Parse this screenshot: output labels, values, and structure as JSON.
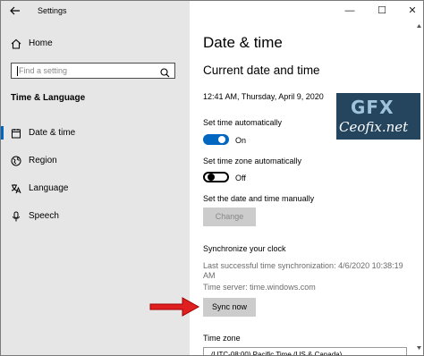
{
  "app": {
    "title": "Settings"
  },
  "sidebar": {
    "home_label": "Home",
    "search_placeholder": "Find a setting",
    "section_title": "Time & Language",
    "items": [
      {
        "label": "Date & time",
        "icon": "clock-icon",
        "active": true
      },
      {
        "label": "Region",
        "icon": "globe-icon"
      },
      {
        "label": "Language",
        "icon": "language-icon"
      },
      {
        "label": "Speech",
        "icon": "microphone-icon"
      }
    ]
  },
  "window_controls": {
    "minimize": "—",
    "maximize": "☐",
    "close": "✕"
  },
  "main": {
    "title": "Date & time",
    "subtitle": "Current date and time",
    "current_datetime": "12:41 AM, Thursday, April 9, 2020",
    "set_time_auto": {
      "label": "Set time automatically",
      "state": "On",
      "on": true
    },
    "set_tz_auto": {
      "label": "Set time zone automatically",
      "state": "Off",
      "on": false
    },
    "set_manual": {
      "label": "Set the date and time manually",
      "button": "Change"
    },
    "sync": {
      "heading": "Synchronize your clock",
      "last_sync_line1": "Last successful time synchronization: 4/6/2020 10:38:19",
      "last_sync_line2": "AM",
      "server": "Time server: time.windows.com",
      "button": "Sync now"
    },
    "timezone": {
      "heading": "Time zone",
      "value": "(UTC-08:00) Pacific Time (US & Canada)"
    }
  },
  "watermark": {
    "logo": "GFX",
    "site": "Ceofix.net"
  },
  "colors": {
    "accent": "#0067c0",
    "sidebar_bg": "#e6e6e6",
    "arrow": "#e02020",
    "button_bg": "#cccccc"
  }
}
